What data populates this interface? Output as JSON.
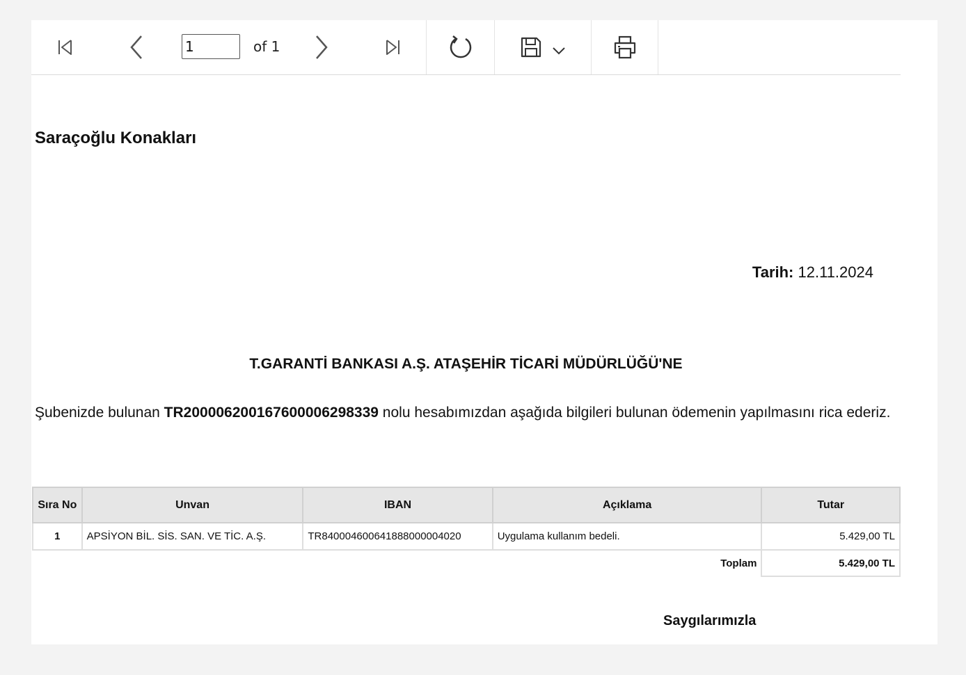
{
  "toolbar": {
    "page_current": "1",
    "page_of": "of 1",
    "icons": {
      "first": "first-page-icon",
      "prev": "previous-page-icon",
      "next": "next-page-icon",
      "last": "last-page-icon",
      "refresh": "refresh-icon",
      "save": "save-icon",
      "save_menu": "chevron-down-icon",
      "print": "print-icon"
    }
  },
  "document": {
    "company_name": "Saraçoğlu Konakları",
    "date_label": "Tarih:",
    "date_value": "12.11.2024",
    "recipient": "T.GARANTİ BANKASI A.Ş. ATAŞEHİR TİCARİ MÜDÜRLÜĞÜ'NE",
    "body_prefix": "Şubenizde bulunan ",
    "account_no": "TR200006200167600006298339",
    "body_suffix": " nolu hesabımızdan aşağıda bilgileri bulunan ödemenin yapılmasını rica ederiz.",
    "table": {
      "headers": {
        "no": "Sıra No",
        "unvan": "Unvan",
        "iban": "IBAN",
        "aciklama": "Açıklama",
        "tutar": "Tutar"
      },
      "rows": [
        {
          "no": "1",
          "unvan": "APSİYON BİL. SİS. SAN. VE TİC. A.Ş.",
          "iban": "TR840004600641888000004020",
          "aciklama": "Uygulama kullanım bedeli.",
          "tutar": "5.429,00 TL"
        }
      ],
      "total_label": "Toplam",
      "total_value": "5.429,00 TL"
    },
    "closing": "Saygılarımızla"
  }
}
